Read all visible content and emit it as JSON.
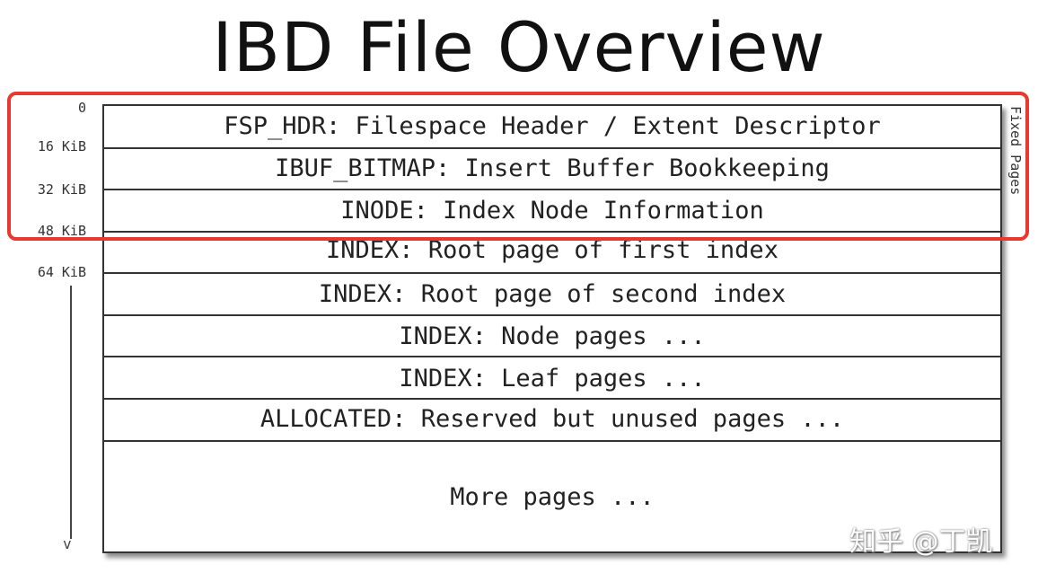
{
  "title": "IBD File Overview",
  "offsets": [
    "0",
    "16 KiB",
    "32 KiB",
    "48 KiB",
    "64 KiB"
  ],
  "pages": [
    "FSP_HDR: Filespace Header / Extent Descriptor",
    "IBUF_BITMAP: Insert Buffer Bookkeeping",
    "INODE: Index Node Information",
    "INDEX: Root page of first index",
    "INDEX: Root page of second index",
    "INDEX: Node pages ...",
    "INDEX: Leaf pages ...",
    "ALLOCATED: Reserved but unused pages ...",
    "More pages ..."
  ],
  "fixed_pages_label": "Fixed Pages",
  "axis_arrow": "v",
  "watermark": "知乎 @丁凯",
  "colors": {
    "highlight": "#e8382f",
    "border": "#333333",
    "text": "#222222"
  }
}
